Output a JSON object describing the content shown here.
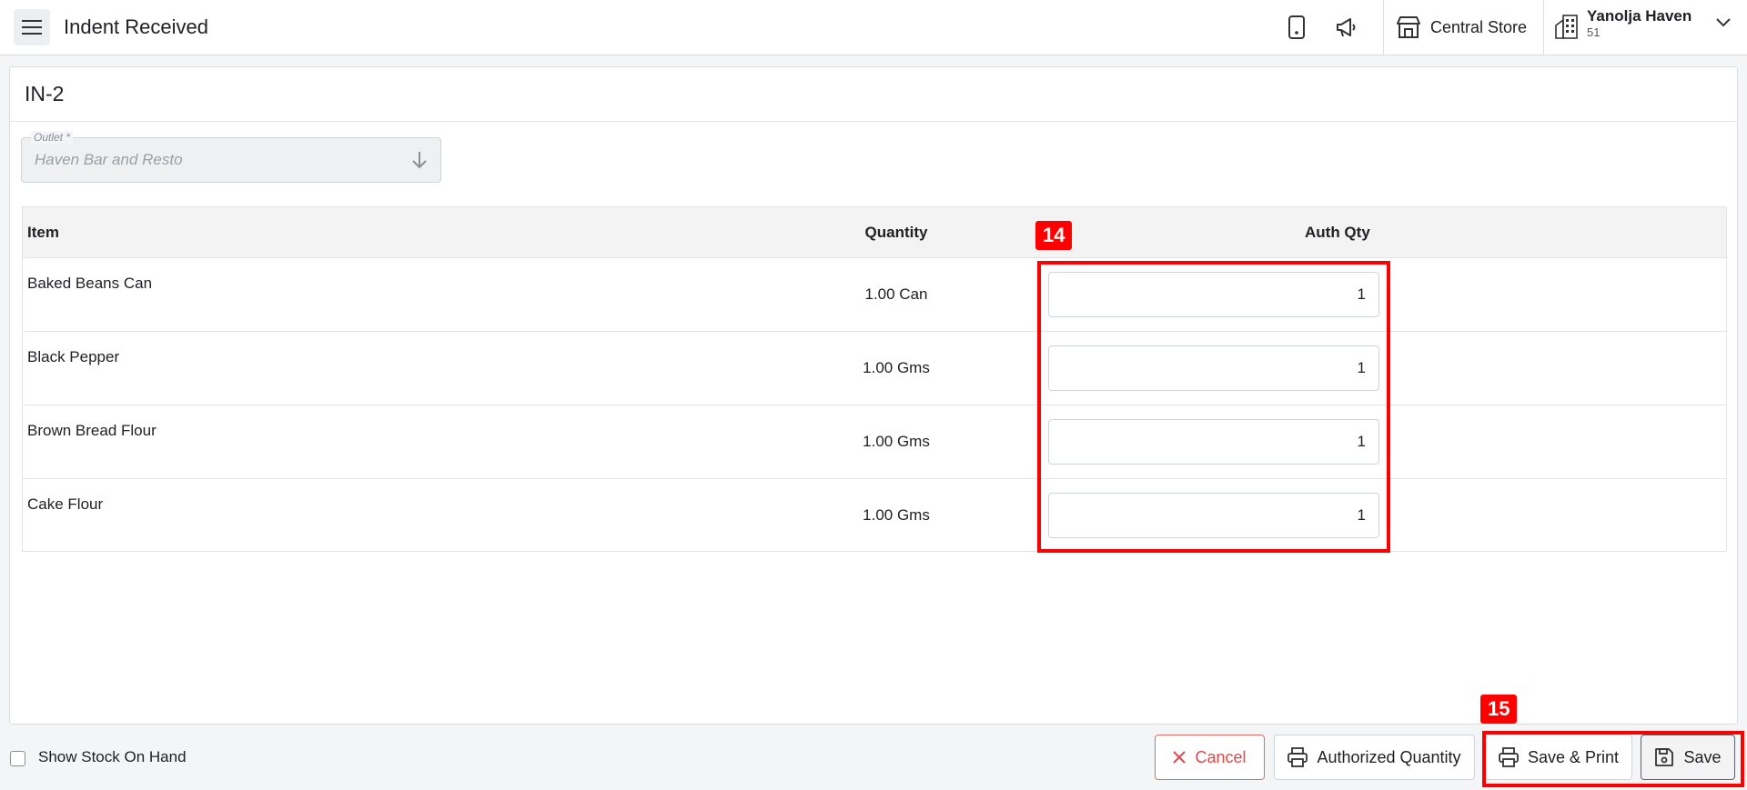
{
  "header": {
    "title": "Indent Received",
    "store": "Central Store",
    "user_name": "Yanolja Haven",
    "user_sub": "51",
    "icons": [
      "menu-icon",
      "mobile-icon",
      "megaphone-icon",
      "store-icon",
      "building-icon",
      "chevron-down-icon"
    ]
  },
  "document": {
    "title": "IN-2",
    "outlet_label": "Outlet *",
    "outlet_value": "Haven Bar and Resto"
  },
  "table": {
    "columns": [
      "Item",
      "Quantity",
      "Auth Qty"
    ],
    "rows": [
      {
        "item": "Baked Beans Can",
        "quantity": "1.00 Can",
        "auth_qty": "1"
      },
      {
        "item": "Black Pepper",
        "quantity": "1.00 Gms",
        "auth_qty": "1"
      },
      {
        "item": "Brown Bread Flour",
        "quantity": "1.00 Gms",
        "auth_qty": "1"
      },
      {
        "item": "Cake Flour",
        "quantity": "1.00 Gms",
        "auth_qty": "1"
      }
    ]
  },
  "footer": {
    "show_stock_label": "Show Stock On Hand",
    "cancel_label": "Cancel",
    "authorized_label": "Authorized Quantity",
    "save_print_label": "Save & Print",
    "save_label": "Save"
  },
  "annotations": {
    "tag_14": "14",
    "tag_15": "15",
    "color": "#ff0000"
  }
}
